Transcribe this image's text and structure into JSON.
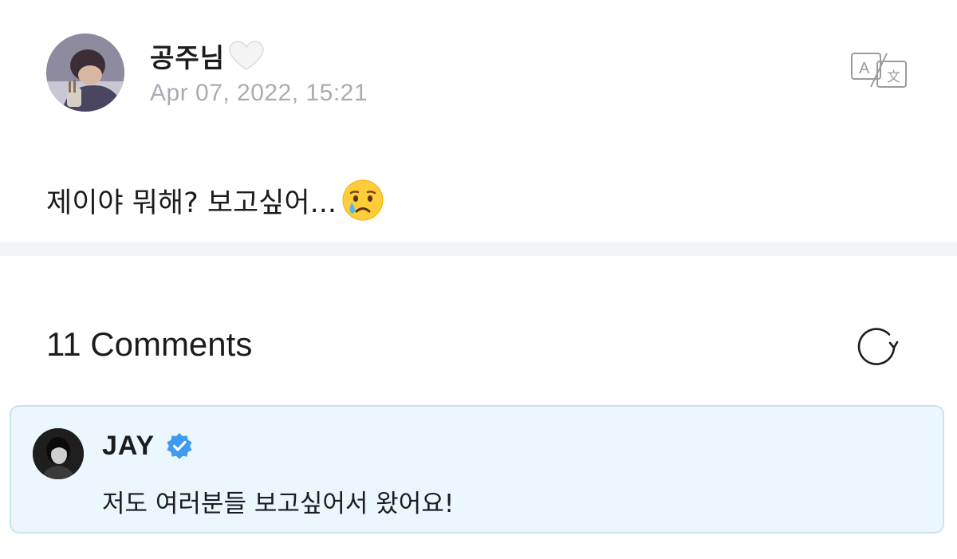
{
  "post": {
    "author_name": "공주님",
    "author_badge_icon": "white-heart-icon",
    "date": "Apr 07, 2022, 15:21",
    "body_text": "제이야 뭐해? 보고싶어...",
    "body_emoji_icon": "crying-face-emoji",
    "translate_icon": "translate-icon"
  },
  "comments": {
    "title": "11 Comments",
    "refresh_icon": "refresh-icon",
    "items": [
      {
        "author": "JAY",
        "verified": true,
        "verified_color": "#3e9bf0",
        "text": "저도 여러분들 보고싶어서 왔어요!"
      }
    ]
  },
  "colors": {
    "date_gray": "#a9acb3",
    "divider_band": "#f3f4f8",
    "comment_bg": "#ecf7fd",
    "comment_border": "#c8e3f1"
  }
}
